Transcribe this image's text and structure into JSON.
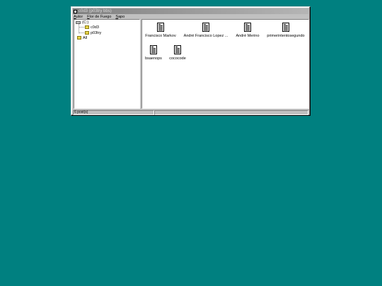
{
  "window": {
    "title": "c0d3 (p03try bbs)"
  },
  "menu": {
    "items": [
      {
        "underline": "A",
        "rest": "utor"
      },
      {
        "underline": "F",
        "rest": "lor de Fuego"
      },
      {
        "underline": "S",
        "rest": "apo"
      }
    ]
  },
  "tree": {
    "drive": "(C:)",
    "folders": [
      "c0d3",
      "p03try"
    ],
    "all": "All"
  },
  "files": [
    {
      "label": "Francisco Markov"
    },
    {
      "label": "André Francisco Lopez ..."
    },
    {
      "label": "André Merino"
    },
    {
      "label": "primerintentosegundo"
    },
    {
      "label": "bsaenops"
    },
    {
      "label": "cococode"
    }
  ],
  "status": {
    "count": "6 post(s)"
  },
  "colors": {
    "desktop": "#008080",
    "window": "#c0c0c0",
    "titlebar_inactive": "#808080"
  },
  "icons": {
    "title": "window-icon",
    "drive": "drive-icon",
    "folder": "folder-icon",
    "file": "document-icon"
  }
}
